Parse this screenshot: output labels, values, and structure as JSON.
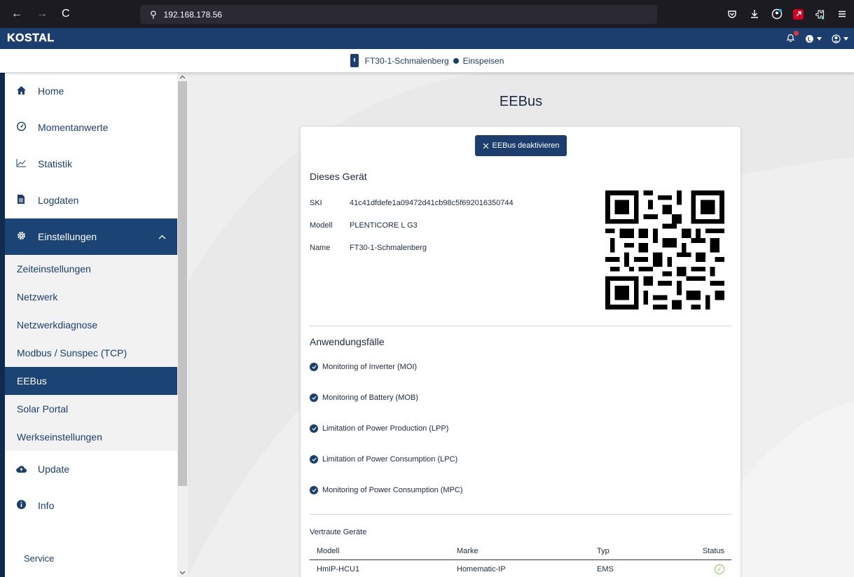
{
  "browser": {
    "url": "192.168.178.56",
    "nav": [
      "←",
      "→",
      "C"
    ]
  },
  "header": {
    "logo": "KOSTAL"
  },
  "device_bar": {
    "device_name": "FT30-1-Schmalenberg",
    "mode": "Einspeisen"
  },
  "sidebar": {
    "items": [
      {
        "label": "Home",
        "icon": "home-icon"
      },
      {
        "label": "Momentanwerte",
        "icon": "gauge-icon"
      },
      {
        "label": "Statistik",
        "icon": "chart-icon"
      },
      {
        "label": "Logdaten",
        "icon": "file-icon"
      },
      {
        "label": "Einstellungen",
        "icon": "gear-icon"
      },
      {
        "label": "Update",
        "icon": "cloud-upload-icon"
      },
      {
        "label": "Info",
        "icon": "info-icon"
      }
    ],
    "sub_items": [
      "Zeiteinstellungen",
      "Netzwerk",
      "Netzwerkdiagnose",
      "Modbus / Sunspec (TCP)",
      "EEBus",
      "Solar Portal",
      "Werkseinstellungen"
    ],
    "service": "Service"
  },
  "main": {
    "title": "EEBus",
    "deactivate_button": "EEBus deaktivieren",
    "device_section": {
      "title": "Dieses Gerät",
      "rows": [
        {
          "key": "SKI",
          "value": "41c41dfdefe1a09472d41cb98c5f692016350744"
        },
        {
          "key": "Modell",
          "value": "PLENTICORE L G3"
        },
        {
          "key": "Name",
          "value": "FT30-1-Schmalenberg"
        }
      ]
    },
    "usecases_title": "Anwendungsfälle",
    "usecases": [
      "Monitoring of Inverter (MOI)",
      "Monitoring of Battery (MOB)",
      "Limitation of Power Production (LPP)",
      "Limitation of Power Consumption (LPC)",
      "Monitoring of Power Consumption (MPC)"
    ],
    "trusted": {
      "title": "Vertraute Geräte",
      "headers": [
        "Modell",
        "Marke",
        "Typ",
        "Status"
      ],
      "rows": [
        {
          "modell": "HmIP-HCU1",
          "marke": "Homematic-IP",
          "typ": "EMS"
        }
      ]
    }
  }
}
